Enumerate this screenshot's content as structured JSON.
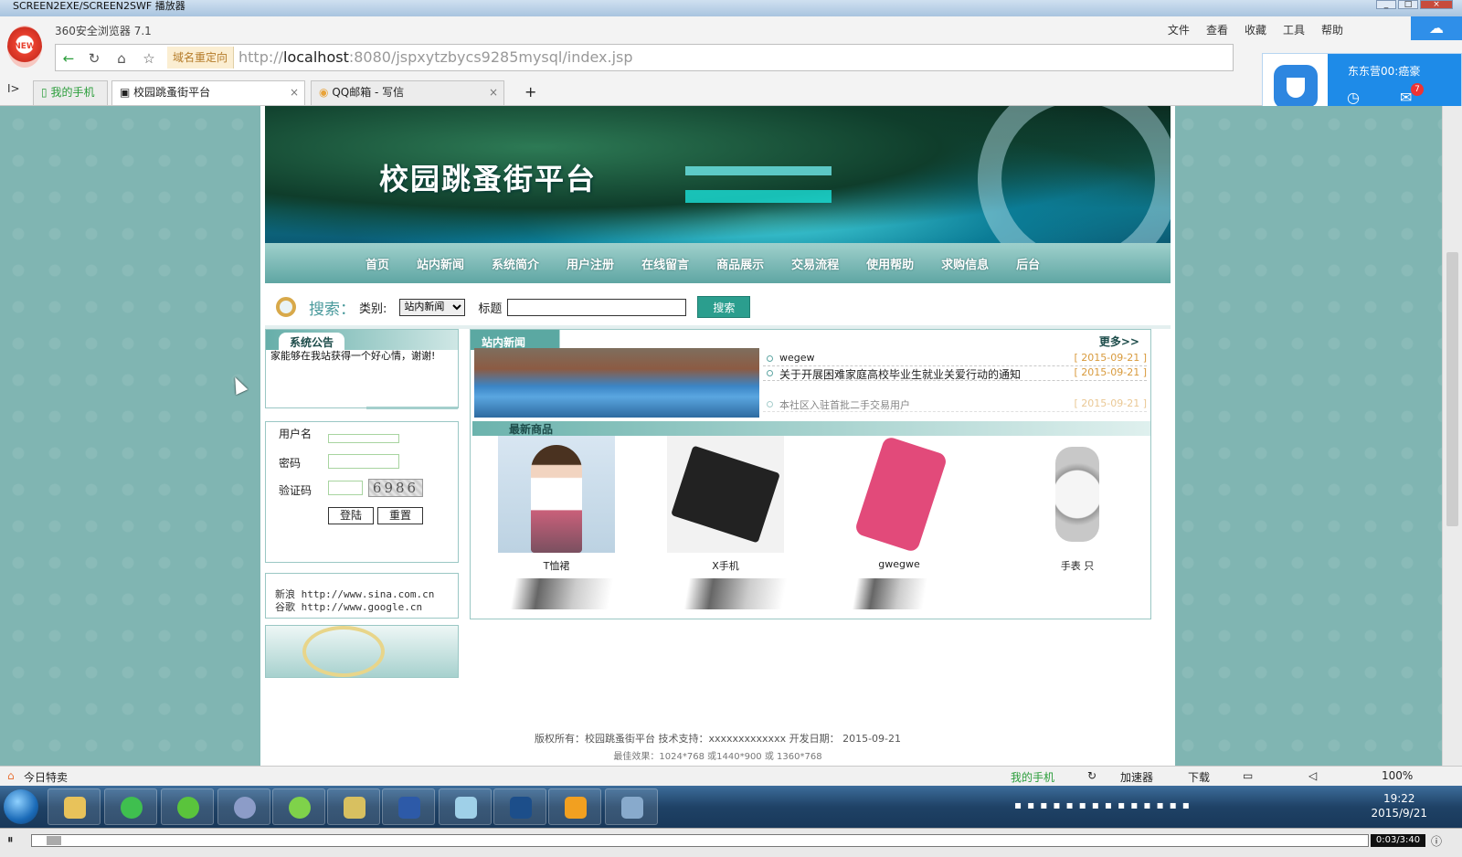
{
  "window": {
    "title": "SCREEN2EXE/SCREEN2SWF 播放器"
  },
  "browser": {
    "name": "360安全浏览器 7.1",
    "menu": [
      "文件",
      "查看",
      "收藏",
      "工具",
      "帮助"
    ],
    "redirect_label": "域名重定向",
    "url_prefix": "http://",
    "url_host": "localhost",
    "url_rest": ":8080/jspxytzbycs9285mysql/index.jsp",
    "side_toggle": "I>",
    "tabs": [
      {
        "label": "我的手机"
      },
      {
        "label": "校园跳蚤街平台",
        "close": "×"
      },
      {
        "label": "QQ邮箱 - 写信",
        "close": "×"
      }
    ],
    "new_tab": "+"
  },
  "notice_popup": {
    "name": "东东营00:癌豪",
    "mail_count": "7"
  },
  "site": {
    "title": "校园跳蚤街平台",
    "nav": [
      "首页",
      "站内新闻",
      "系统简介",
      "用户注册",
      "在线留言",
      "商品展示",
      "交易流程",
      "使用帮助",
      "求购信息",
      "后台"
    ],
    "search": {
      "label": "搜索：",
      "type_label": "类别:",
      "type_value": "站内新闻",
      "title_label": "标题",
      "button": "搜索"
    },
    "announcement": {
      "header": "系统公告",
      "text": "家能够在我站获得一个好心情，谢谢!"
    },
    "login": {
      "username_label": "用户名",
      "password_label": "密码",
      "captcha_label": "验证码",
      "captcha_value": "6986",
      "login_button": "登陆",
      "reset_button": "重置"
    },
    "links": [
      "新浪 http://www.sina.com.cn",
      "谷歌 http://www.google.cn"
    ],
    "news": {
      "header": "站内新闻",
      "more": "更多>>",
      "items": [
        {
          "title": "wegew",
          "date": "[ 2015-09-21 ]"
        },
        {
          "title": "关于开展困难家庭高校毕业生就业关爱行动的通知",
          "date": "[ 2015-09-21 ]"
        },
        {
          "title": "本社区入驻首批二手交易用户",
          "date": "[ 2015-09-21 ]"
        }
      ]
    },
    "products": {
      "header": "最新商品",
      "items": [
        {
          "name": "T恤裙"
        },
        {
          "name": "X手机"
        },
        {
          "name": "gwegwe"
        },
        {
          "name": "手表  只"
        }
      ]
    },
    "footer": {
      "copyright": "版权所有：校园跳蚤街平台 技术支持：xxxxxxxxxxxxx 开发日期： 2015-09-21",
      "best_view": "最佳效果：1024*768 或1440*900 或 1360*768"
    }
  },
  "statusbar": {
    "left": "今日特卖",
    "items": [
      "我的手机",
      "加速器",
      "下载",
      "100%"
    ]
  },
  "taskbar": {
    "time": "19:22",
    "date": "2015/9/21"
  },
  "player": {
    "time": "0:03/3:40"
  }
}
